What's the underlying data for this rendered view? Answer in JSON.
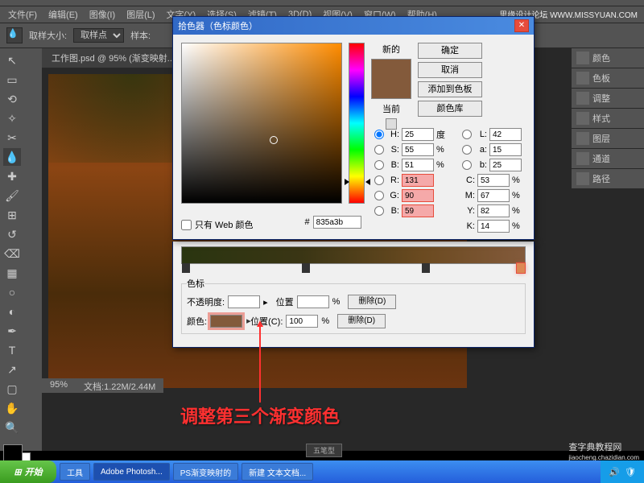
{
  "menubar": {
    "items": [
      "文件(F)",
      "编辑(E)",
      "图像(I)",
      "图层(L)",
      "文字(Y)",
      "选择(S)",
      "滤镜(T)",
      "3D(D)",
      "视图(V)",
      "窗口(W)",
      "帮助(H)"
    ]
  },
  "optionsbar": {
    "sample_size_label": "取样大小:",
    "sample_size_value": "取样点",
    "sample_label": "样本:"
  },
  "document": {
    "tab": "工作图.psd @ 95% (渐变映射...",
    "zoom": "95%",
    "doc_size": "文档:1.22M/2.44M"
  },
  "panels": {
    "items": [
      "颜色",
      "色板",
      "调整",
      "样式",
      "图层",
      "通道",
      "路径"
    ]
  },
  "color_picker": {
    "title": "拾色器（色标颜色）",
    "new_label": "新的",
    "current_label": "当前",
    "ok": "确定",
    "cancel": "取消",
    "add_swatch": "添加到色板",
    "color_lib": "颜色库",
    "web_only": "只有 Web 颜色",
    "hex_prefix": "#",
    "hex": "835a3b",
    "H": "25",
    "H_unit": "度",
    "S": "55",
    "S_unit": "%",
    "Bv": "51",
    "Bv_unit": "%",
    "R": "131",
    "G": "90",
    "Bb": "59",
    "L": "42",
    "a": "15",
    "b2": "25",
    "C": "53",
    "C_unit": "%",
    "M": "67",
    "M_unit": "%",
    "Y": "82",
    "Y_unit": "%",
    "K": "14",
    "K_unit": "%"
  },
  "gradient": {
    "stops_label": "色标",
    "opacity_label": "不透明度:",
    "pos_label": "位置",
    "pos2_label": "位置(C):",
    "pos_val": "100",
    "pos_unit": "%",
    "color_label": "颜色:",
    "delete": "删除(D)"
  },
  "annotation": "调整第三个渐变颜色",
  "watermark": {
    "tr": "思缘设计论坛  WWW.MISSYUAN.COM",
    "br": "查字典教程网",
    "url": "jiaocheng.chazidian.com",
    "bl": "五笔型"
  },
  "taskbar": {
    "start": "开始",
    "btns": [
      "工具",
      "Adobe Photosh...",
      "PS渐变映射的",
      "新建 文本文档..."
    ],
    "time": ""
  }
}
